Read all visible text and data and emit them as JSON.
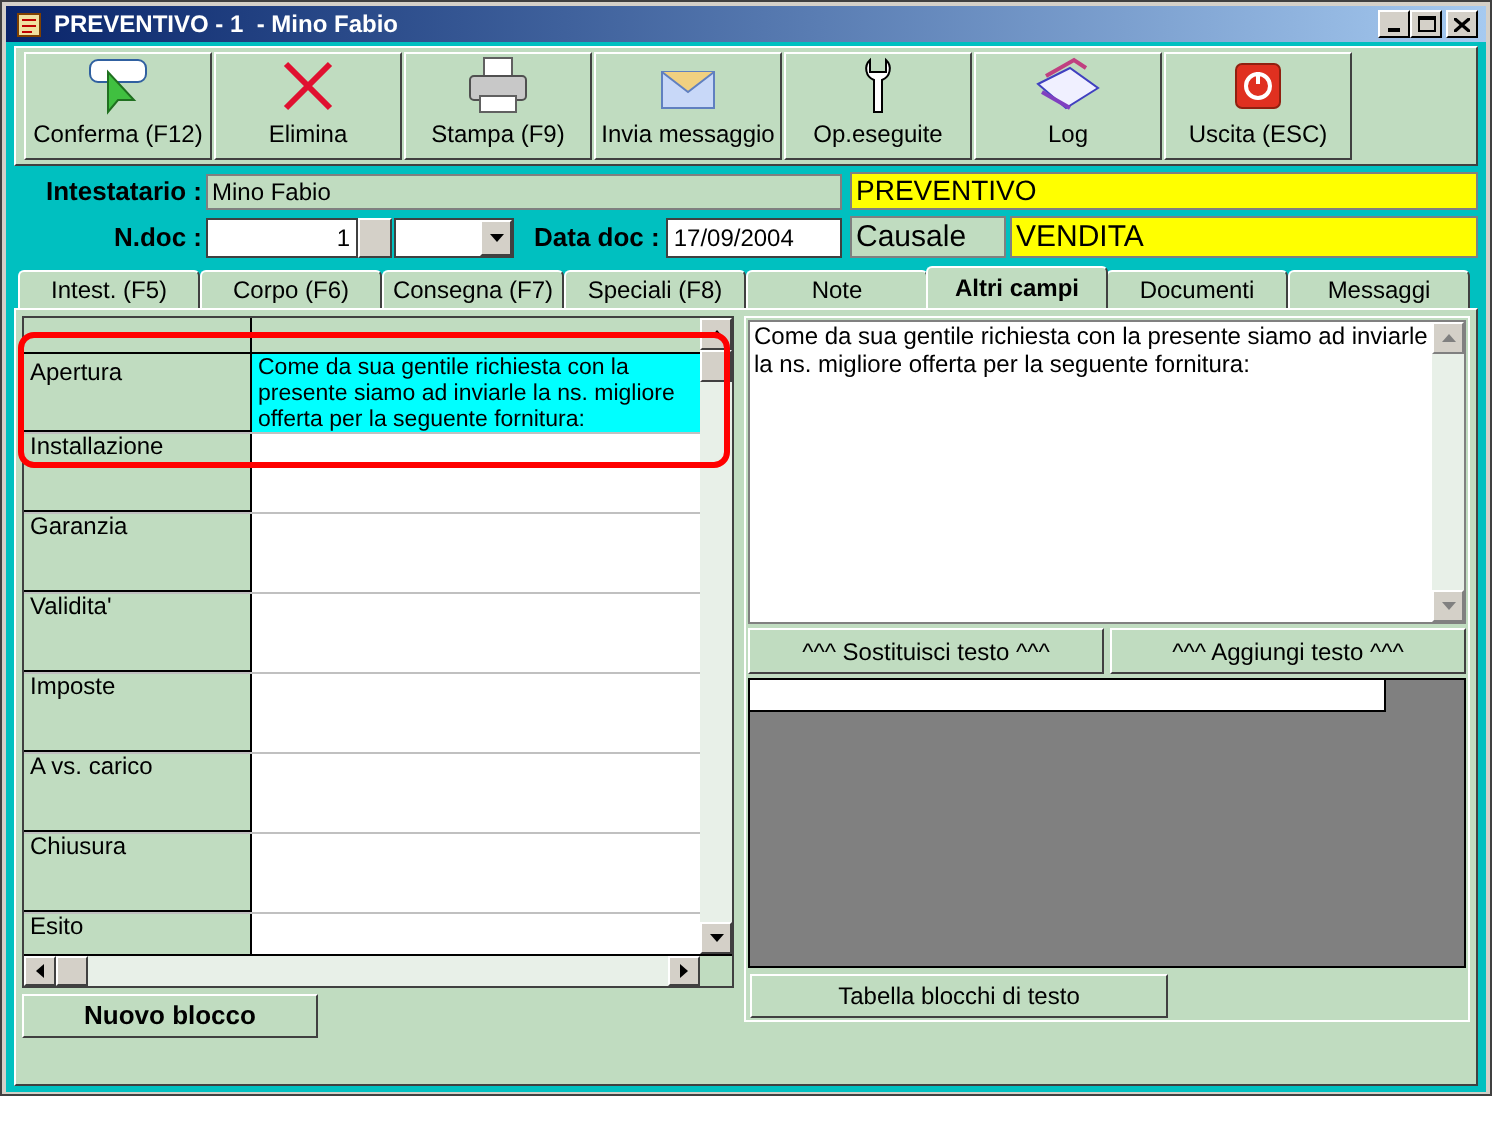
{
  "window": {
    "title": "PREVENTIVO - 1  - Mino Fabio"
  },
  "toolbar": [
    {
      "label": "Conferma (F12)",
      "kind": "ok"
    },
    {
      "label": "Elimina",
      "kind": "delete"
    },
    {
      "label": "Stampa (F9)",
      "kind": "print"
    },
    {
      "label": "Invia messaggio",
      "kind": "mail"
    },
    {
      "label": "Op.eseguite",
      "kind": "wrench"
    },
    {
      "label": "Log",
      "kind": "log"
    },
    {
      "label": "Uscita (ESC)",
      "kind": "exit"
    }
  ],
  "header": {
    "holder_label": "Intestatario :",
    "holder_value": "Mino Fabio",
    "doc_label": "N.doc :",
    "doc_number": "1",
    "date_label": "Data doc :",
    "date_value": "17/09/2004",
    "doc_type": "PREVENTIVO",
    "causale_label": "Causale",
    "causale_value": "VENDITA"
  },
  "tabs": [
    {
      "label": "Intest. (F5)",
      "selected": false
    },
    {
      "label": "Corpo (F6)",
      "selected": false
    },
    {
      "label": "Consegna (F7)",
      "selected": false
    },
    {
      "label": "Speciali (F8)",
      "selected": false
    },
    {
      "label": "Note",
      "selected": false
    },
    {
      "label": "Altri campi",
      "selected": true
    },
    {
      "label": "Documenti",
      "selected": false
    },
    {
      "label": "Messaggi",
      "selected": false
    }
  ],
  "grid": {
    "rows": [
      {
        "label": "Apertura",
        "value": "Come da sua gentile richiesta con la presente siamo ad inviarle la ns. migliore offerta per la seguente fornitura:",
        "selected": true
      },
      {
        "label": "Installazione",
        "selected": false
      },
      {
        "label": "Garanzia",
        "selected": false
      },
      {
        "label": "Validita'",
        "selected": false
      },
      {
        "label": "Imposte",
        "selected": false
      },
      {
        "label": "A vs. carico",
        "selected": false
      },
      {
        "label": "Chiusura",
        "selected": false
      },
      {
        "label": "Esito",
        "selected": false
      }
    ],
    "highlighted": true
  },
  "new_block_button": "Nuovo blocco",
  "editor": {
    "text": "Come da sua gentile richiesta con la presente siamo ad inviarle la ns. migliore offerta per la seguente fornitura:"
  },
  "editor_buttons": [
    "^^^ Sostituisci testo ^^^",
    "^^^ Aggiungi testo ^^^"
  ],
  "table_button": "Tabella blocchi di testo"
}
